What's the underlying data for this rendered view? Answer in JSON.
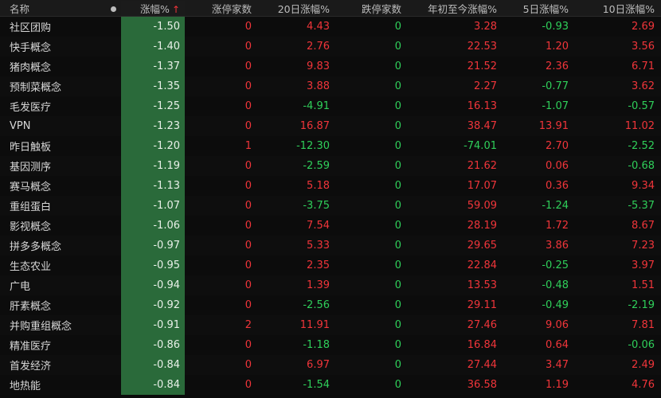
{
  "header": {
    "name": "名称",
    "pct": "涨幅%",
    "up_count": "涨停家数",
    "d20": "20日涨幅%",
    "down_count": "跌停家数",
    "ytd": "年初至今涨幅%",
    "d5": "5日涨幅%",
    "d10": "10日涨幅%",
    "sort_indicator": "↑"
  },
  "rows": [
    {
      "name": "社区团购",
      "pct": "-1.50",
      "up": "0",
      "d20": "4.43",
      "down": "0",
      "ytd": "3.28",
      "d5": "-0.93",
      "d10": "2.69"
    },
    {
      "name": "快手概念",
      "pct": "-1.40",
      "up": "0",
      "d20": "2.76",
      "down": "0",
      "ytd": "22.53",
      "d5": "1.20",
      "d10": "3.56"
    },
    {
      "name": "猪肉概念",
      "pct": "-1.37",
      "up": "0",
      "d20": "9.83",
      "down": "0",
      "ytd": "21.52",
      "d5": "2.36",
      "d10": "6.71"
    },
    {
      "name": "预制菜概念",
      "pct": "-1.35",
      "up": "0",
      "d20": "3.88",
      "down": "0",
      "ytd": "2.27",
      "d5": "-0.77",
      "d10": "3.62"
    },
    {
      "name": "毛发医疗",
      "pct": "-1.25",
      "up": "0",
      "d20": "-4.91",
      "down": "0",
      "ytd": "16.13",
      "d5": "-1.07",
      "d10": "-0.57"
    },
    {
      "name": "VPN",
      "pct": "-1.23",
      "up": "0",
      "d20": "16.87",
      "down": "0",
      "ytd": "38.47",
      "d5": "13.91",
      "d10": "11.02"
    },
    {
      "name": "昨日触板",
      "pct": "-1.20",
      "up": "1",
      "d20": "-12.30",
      "down": "0",
      "ytd": "-74.01",
      "d5": "2.70",
      "d10": "-2.52"
    },
    {
      "name": "基因测序",
      "pct": "-1.19",
      "up": "0",
      "d20": "-2.59",
      "down": "0",
      "ytd": "21.62",
      "d5": "0.06",
      "d10": "-0.68"
    },
    {
      "name": "赛马概念",
      "pct": "-1.13",
      "up": "0",
      "d20": "5.18",
      "down": "0",
      "ytd": "17.07",
      "d5": "0.36",
      "d10": "9.34"
    },
    {
      "name": "重组蛋白",
      "pct": "-1.07",
      "up": "0",
      "d20": "-3.75",
      "down": "0",
      "ytd": "59.09",
      "d5": "-1.24",
      "d10": "-5.37"
    },
    {
      "name": "影视概念",
      "pct": "-1.06",
      "up": "0",
      "d20": "7.54",
      "down": "0",
      "ytd": "28.19",
      "d5": "1.72",
      "d10": "8.67"
    },
    {
      "name": "拼多多概念",
      "pct": "-0.97",
      "up": "0",
      "d20": "5.33",
      "down": "0",
      "ytd": "29.65",
      "d5": "3.86",
      "d10": "7.23"
    },
    {
      "name": "生态农业",
      "pct": "-0.95",
      "up": "0",
      "d20": "2.35",
      "down": "0",
      "ytd": "22.84",
      "d5": "-0.25",
      "d10": "3.97"
    },
    {
      "name": "广电",
      "pct": "-0.94",
      "up": "0",
      "d20": "1.39",
      "down": "0",
      "ytd": "13.53",
      "d5": "-0.48",
      "d10": "1.51"
    },
    {
      "name": "肝素概念",
      "pct": "-0.92",
      "up": "0",
      "d20": "-2.56",
      "down": "0",
      "ytd": "29.11",
      "d5": "-0.49",
      "d10": "-2.19"
    },
    {
      "name": "并购重组概念",
      "pct": "-0.91",
      "up": "2",
      "d20": "11.91",
      "down": "0",
      "ytd": "27.46",
      "d5": "9.06",
      "d10": "7.81"
    },
    {
      "name": "精准医疗",
      "pct": "-0.86",
      "up": "0",
      "d20": "-1.18",
      "down": "0",
      "ytd": "16.84",
      "d5": "0.64",
      "d10": "-0.06"
    },
    {
      "name": "首发经济",
      "pct": "-0.84",
      "up": "0",
      "d20": "6.97",
      "down": "0",
      "ytd": "27.44",
      "d5": "3.47",
      "d10": "2.49"
    },
    {
      "name": "地热能",
      "pct": "-0.84",
      "up": "0",
      "d20": "-1.54",
      "down": "0",
      "ytd": "36.58",
      "d5": "1.19",
      "d10": "4.76"
    }
  ]
}
